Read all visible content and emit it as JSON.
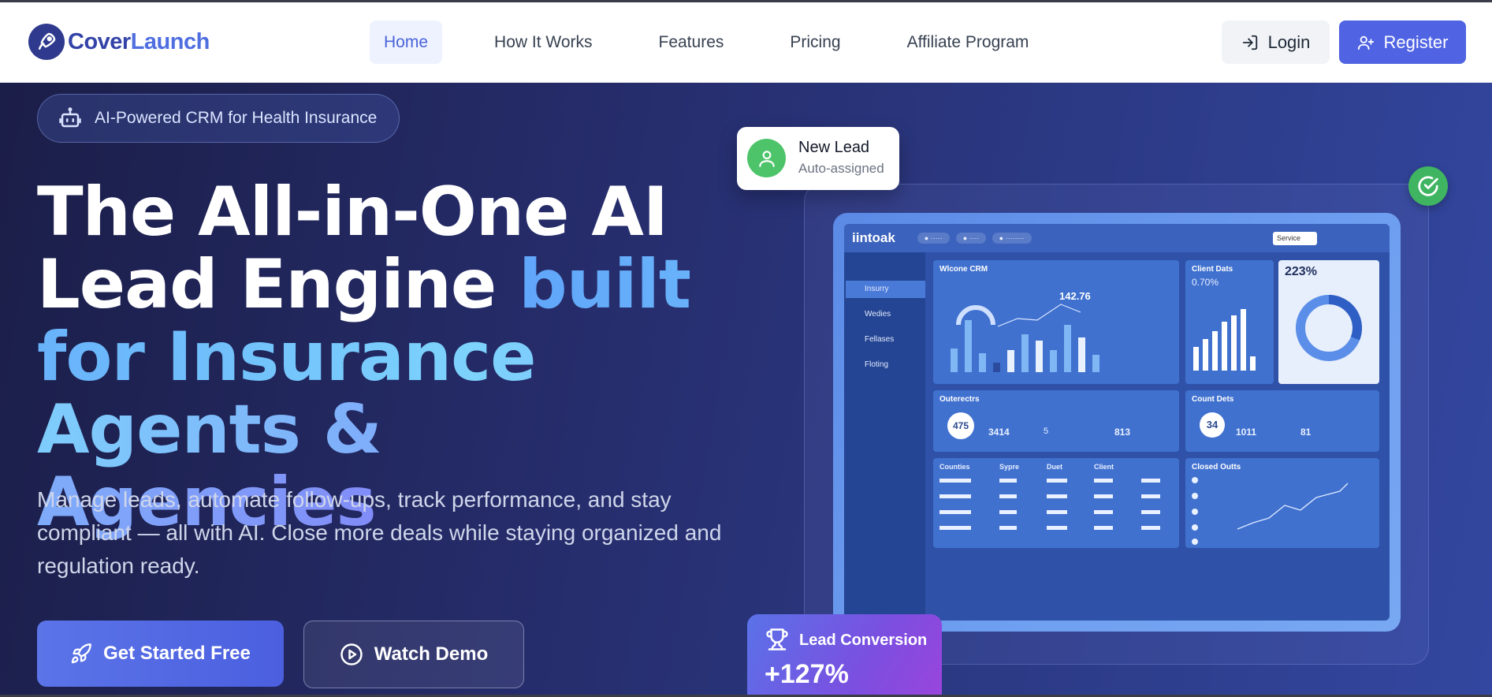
{
  "header": {
    "logo": {
      "part1": "Cover",
      "part2": "Launch",
      "icon": "rocket-icon"
    },
    "nav": [
      {
        "label": "Home",
        "active": true
      },
      {
        "label": "How It Works",
        "active": false
      },
      {
        "label": "Features",
        "active": false
      },
      {
        "label": "Pricing",
        "active": false
      },
      {
        "label": "Affiliate Program",
        "active": false
      }
    ],
    "login_label": "Login",
    "register_label": "Register"
  },
  "hero": {
    "pill_label": "AI-Powered CRM for Health Insurance",
    "headline_white": "The All-in-One AI Lead Engine ",
    "headline_gradient": "built for Insurance Agents & Agencies",
    "subtext": "Manage leads, automate follow-ups, track performance, and stay compliant — all with AI. Close more deals while staying organized and regulation ready.",
    "cta_primary": "Get Started Free",
    "cta_secondary": "Watch Demo"
  },
  "visual": {
    "new_lead_title": "New Lead",
    "new_lead_sub": "Auto-assigned",
    "conversion_title": "Lead Conversion",
    "conversion_value": "+127%",
    "dashboard": {
      "brand": "iintoak",
      "search_placeholder": "Service",
      "side_items": [
        "Insurry",
        "Wedies",
        "Fellases",
        "Floting"
      ],
      "welcome_title": "Wlcone CRM",
      "welcome_metric": "142.76",
      "client_data_title": "Client Dats",
      "client_data_pct": "0.70%",
      "donut_pct": "223%",
      "overview_title": "Outerectrs",
      "overview_num": "475",
      "stat1": "3414",
      "stat2": "5",
      "stat3": "813",
      "count_title": "Count Dets",
      "count_num": "34",
      "count_val1": "1011",
      "count_val2": "81",
      "table_headers": [
        "Counties",
        "Sypre",
        "Duet",
        "Client"
      ],
      "closed_title": "Closed Outts"
    }
  },
  "colors": {
    "brand": "#4f63e3",
    "accent_green": "#3fb461"
  }
}
